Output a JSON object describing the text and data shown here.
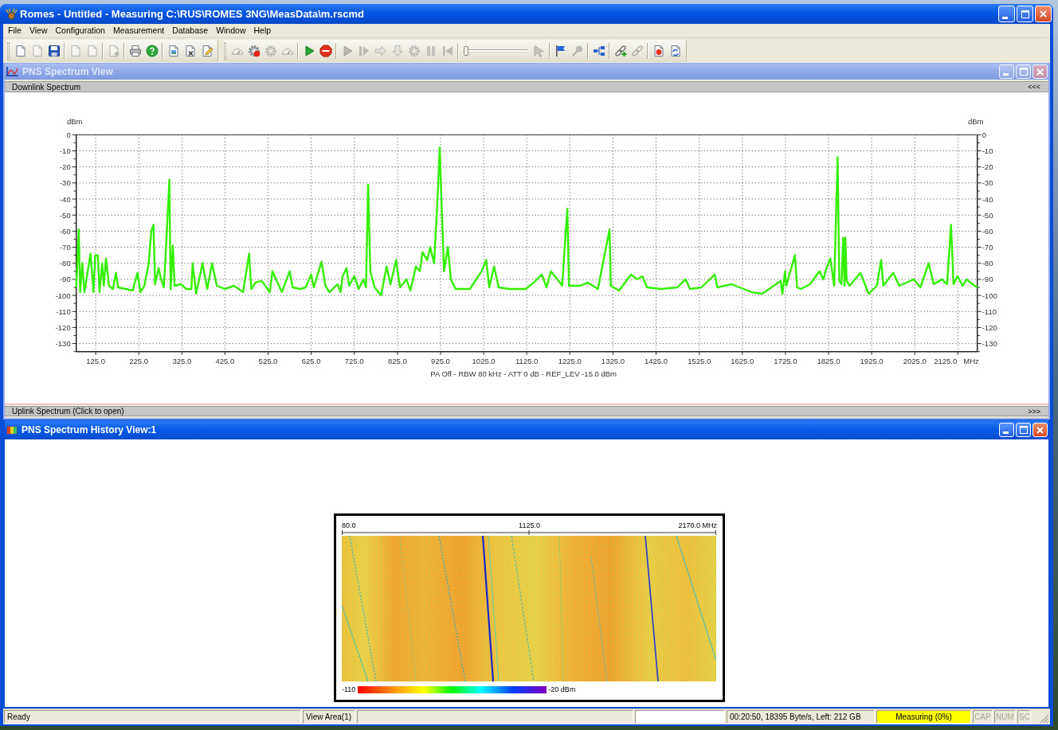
{
  "window": {
    "title": "Romes - Untitled - Measuring C:\\RUS\\ROMES 3NG\\MeasData\\m.rscmd",
    "active": true
  },
  "menu": [
    "File",
    "View",
    "Configuration",
    "Measurement",
    "Database",
    "Window",
    "Help"
  ],
  "toolbars": [
    [
      [
        {
          "kind": "page",
          "disabled": false
        },
        {
          "kind": "page",
          "disabled": true
        },
        {
          "kind": "save",
          "disabled": false
        }
      ],
      [
        {
          "kind": "page",
          "disabled": true
        },
        {
          "kind": "page",
          "disabled": true
        }
      ],
      [
        {
          "kind": "addpage",
          "disabled": true
        }
      ],
      [
        {
          "kind": "printer",
          "disabled": false
        },
        {
          "kind": "help",
          "disabled": false
        }
      ],
      [
        {
          "kind": "image",
          "disabled": false
        },
        {
          "kind": "delete",
          "disabled": false
        },
        {
          "kind": "edit",
          "disabled": false
        }
      ]
    ],
    [
      [
        {
          "kind": "gauge",
          "disabled": true
        },
        {
          "kind": "gearrecord",
          "disabled": false
        },
        {
          "kind": "gear",
          "disabled": true
        },
        {
          "kind": "gauge",
          "disabled": true
        }
      ],
      [
        {
          "kind": "play",
          "disabled": false
        },
        {
          "kind": "stop",
          "disabled": false
        }
      ],
      [
        {
          "kind": "play",
          "disabled": true
        },
        {
          "kind": "step",
          "disabled": true
        },
        {
          "kind": "arrow",
          "disabled": true
        },
        {
          "kind": "downarrow",
          "disabled": true
        },
        {
          "kind": "gear",
          "disabled": true
        },
        {
          "kind": "pause",
          "disabled": true
        },
        {
          "kind": "rewind",
          "disabled": true
        }
      ],
      [
        {
          "kind": "slider",
          "level": 0,
          "disabled": false
        },
        {
          "kind": "pointer",
          "disabled": true
        }
      ],
      [
        {
          "kind": "flag",
          "disabled": false
        },
        {
          "kind": "pin",
          "disabled": true
        }
      ],
      [
        {
          "kind": "tree",
          "disabled": false
        }
      ],
      [
        {
          "kind": "linkadd",
          "disabled": false
        },
        {
          "kind": "link",
          "disabled": true
        }
      ],
      [
        {
          "kind": "record",
          "disabled": false
        },
        {
          "kind": "refresh",
          "disabled": false
        }
      ]
    ]
  ],
  "spectrum_view": {
    "title": "PNS Spectrum View",
    "active": false,
    "downlink": {
      "label": "Downlink Spectrum",
      "toggle": "<<<",
      "right_unit": "dBm",
      "right_tick_labels": [
        "0",
        "-10",
        "-20",
        "-30",
        "-40",
        "-50",
        "-60",
        "-70",
        "-80",
        "-90",
        "-100",
        "-110",
        "-120",
        "-130"
      ],
      "x_unit": "MHz",
      "caption": "PA Off - RBW 80 kHz - ATT 0 dB - REF_LEV -15.0 dBm",
      "chart_data": {
        "type": "line",
        "ylabel": "dBm",
        "grid": true,
        "xlim": [
          80,
          2170
        ],
        "ylim": [
          -135,
          0
        ],
        "xticks": [
          {
            "value": 125,
            "label": "125.0"
          },
          {
            "value": 225,
            "label": "225.0"
          },
          {
            "value": 325,
            "label": "325.0"
          },
          {
            "value": 425,
            "label": "425.0"
          },
          {
            "value": 525,
            "label": "525.0"
          },
          {
            "value": 625,
            "label": "625.0"
          },
          {
            "value": 725,
            "label": "725.0"
          },
          {
            "value": 825,
            "label": "825.0"
          },
          {
            "value": 925,
            "label": "925.0"
          },
          {
            "value": 1025,
            "label": "1025.0"
          },
          {
            "value": 1125,
            "label": "1125.0"
          },
          {
            "value": 1225,
            "label": "1225.0"
          },
          {
            "value": 1325,
            "label": "1325.0"
          },
          {
            "value": 1425,
            "label": "1425.0"
          },
          {
            "value": 1525,
            "label": "1525.0"
          },
          {
            "value": 1625,
            "label": "1625.0"
          },
          {
            "value": 1725,
            "label": "1725.0"
          },
          {
            "value": 1825,
            "label": "1825.0"
          },
          {
            "value": 1925,
            "label": "1925.0"
          },
          {
            "value": 2025,
            "label": "2025.0"
          },
          {
            "value": 2125,
            "label": "2125.0"
          }
        ],
        "yticks": [
          {
            "value": 0,
            "label": "0"
          },
          {
            "value": -10,
            "label": "-10"
          },
          {
            "value": -20,
            "label": "-20"
          },
          {
            "value": -30,
            "label": "-30"
          },
          {
            "value": -40,
            "label": "-40"
          },
          {
            "value": -50,
            "label": "-50"
          },
          {
            "value": -60,
            "label": "-60"
          },
          {
            "value": -70,
            "label": "-70"
          },
          {
            "value": -80,
            "label": "-80"
          },
          {
            "value": -90,
            "label": "-90"
          },
          {
            "value": -100,
            "label": "-100"
          },
          {
            "value": -110,
            "label": "-110"
          },
          {
            "value": -120,
            "label": "-120"
          },
          {
            "value": -130,
            "label": "-130"
          }
        ],
        "x": [
          80,
          86,
          89,
          94,
          99,
          113,
          120,
          124,
          130,
          134,
          140,
          144,
          149,
          156,
          165,
          172,
          177,
          195,
          211,
          222,
          229,
          238,
          248,
          254,
          259,
          263,
          271,
          277,
          283,
          288,
          296,
          299,
          304,
          308,
          323,
          335,
          347,
          350,
          358,
          373,
          384,
          395,
          406,
          425,
          446,
          467,
          481,
          486,
          496,
          510,
          529,
          535,
          557,
          575,
          582,
          600,
          612,
          625,
          631,
          649,
          658,
          667,
          686,
          693,
          698,
          707,
          713,
          725,
          735,
          746,
          752,
          757,
          762,
          772,
          787,
          800,
          809,
          822,
          831,
          846,
          855,
          868,
          877,
          883,
          894,
          901,
          910,
          918,
          923,
          927,
          933,
          942,
          949,
          960,
          993,
          1020,
          1031,
          1038,
          1049,
          1060,
          1085,
          1123,
          1141,
          1160,
          1171,
          1181,
          1196,
          1207,
          1219,
          1223,
          1249,
          1267,
          1290,
          1317,
          1320,
          1339,
          1367,
          1381,
          1393,
          1404,
          1437,
          1474,
          1493,
          1504,
          1530,
          1561,
          1567,
          1600,
          1647,
          1671,
          1714,
          1718,
          1724,
          1727,
          1747,
          1752,
          1761,
          1782,
          1804,
          1813,
          1819,
          1829,
          1838,
          1846,
          1850,
          1855,
          1859,
          1862,
          1864,
          1867,
          1874,
          1899,
          1918,
          1937,
          1947,
          1952,
          1975,
          1989,
          2023,
          2038,
          2057,
          2069,
          2088,
          2100,
          2109,
          2115,
          2124,
          2136,
          2145,
          2164,
          2170
        ],
        "series": [
          {
            "color": "#33f000",
            "values": [
              -95,
              -59,
              -98,
              -80,
              -98,
              -74,
              -98,
              -75,
              -75,
              -98,
              -80,
              -94,
              -77,
              -94,
              -96,
              -86,
              -95,
              -96,
              -97,
              -86,
              -98,
              -94,
              -80,
              -60,
              -56,
              -93,
              -83,
              -90,
              -95,
              -71,
              -28,
              -96,
              -69,
              -94,
              -93,
              -96,
              -96,
              -80,
              -99,
              -80,
              -96,
              -80,
              -94,
              -96,
              -94,
              -98,
              -74,
              -96,
              -92,
              -91,
              -98,
              -85,
              -98,
              -85,
              -95,
              -96,
              -95,
              -87,
              -95,
              -79,
              -94,
              -98,
              -93,
              -98,
              -88,
              -83,
              -94,
              -88,
              -96,
              -90,
              -95,
              -31,
              -85,
              -95,
              -100,
              -82,
              -93,
              -78,
              -95,
              -90,
              -97,
              -82,
              -85,
              -73,
              -78,
              -70,
              -80,
              -40,
              -8,
              -40,
              -85,
              -70,
              -90,
              -96,
              -96,
              -85,
              -78,
              -95,
              -82,
              -95,
              -96,
              -96,
              -92,
              -87,
              -95,
              -85,
              -90,
              -94,
              -46,
              -94,
              -94,
              -92,
              -96,
              -59,
              -94,
              -97,
              -87,
              -90,
              -88,
              -95,
              -96,
              -95,
              -90,
              -96,
              -95,
              -87,
              -95,
              -93,
              -98,
              -99,
              -91,
              -99,
              -85,
              -94,
              -75,
              -95,
              -96,
              -93,
              -85,
              -90,
              -84,
              -77,
              -94,
              -14,
              -91,
              -93,
              -64,
              -94,
              -64,
              -91,
              -94,
              -86,
              -99,
              -94,
              -78,
              -94,
              -86,
              -94,
              -90,
              -95,
              -80,
              -93,
              -90,
              -93,
              -56,
              -93,
              -88,
              -94,
              -90,
              -94,
              -95
            ]
          }
        ]
      }
    },
    "uplink": {
      "label": "Uplink Spectrum (Click to open)",
      "toggle": ">>>"
    }
  },
  "history_view": {
    "title": "PNS Spectrum History View:1",
    "active": true,
    "frequency_scale": [
      "80.0",
      "1125.0",
      "2170.0 MHz"
    ],
    "color_scale": {
      "min_label": "-110",
      "max_label": "-20 dBm"
    }
  },
  "status_bar": {
    "panels": [
      {
        "kind": "text",
        "text": "Ready"
      },
      {
        "kind": "text",
        "text": "View Area(1)"
      },
      {
        "kind": "blank"
      },
      {
        "kind": "field"
      },
      {
        "kind": "text",
        "text": "00:20:50, 18395 Byte/s, Left: 212 GB"
      },
      {
        "kind": "alert",
        "text": "Measuring (0%)"
      },
      {
        "kind": "indicator",
        "text": "CAP",
        "on": false
      },
      {
        "kind": "indicator",
        "text": "NUM",
        "on": false
      },
      {
        "kind": "indicator",
        "text": "SC",
        "on": false
      }
    ]
  }
}
